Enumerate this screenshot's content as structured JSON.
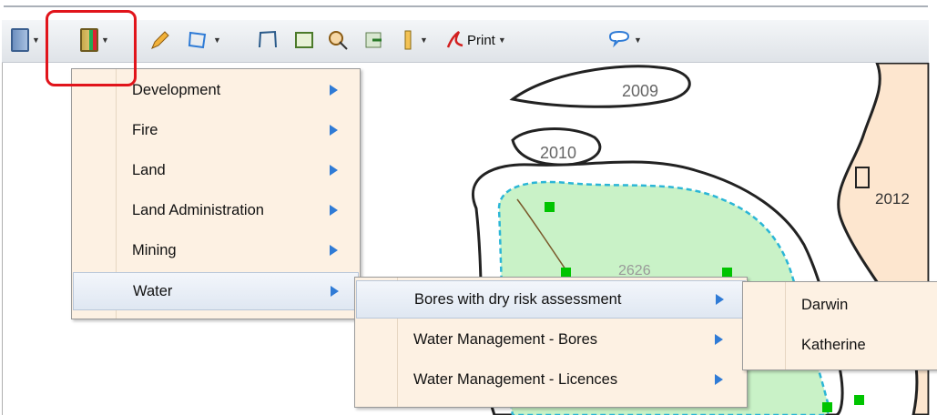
{
  "toolbar": {
    "print_label": "Print",
    "icons": [
      "layers-book-icon",
      "thematic-book-icon",
      "pencil-icon",
      "polygon-select-icon",
      "polyline-icon",
      "polygon-edit-icon",
      "identify-icon",
      "export-icon",
      "brightness-icon",
      "pdf-icon",
      "print-icon",
      "comment-icon"
    ]
  },
  "map": {
    "labels": [
      "2009",
      "2010",
      "2012",
      "2626"
    ]
  },
  "menu1": {
    "items": [
      {
        "label": "Development"
      },
      {
        "label": "Fire"
      },
      {
        "label": "Land"
      },
      {
        "label": "Land Administration"
      },
      {
        "label": "Mining"
      },
      {
        "label": "Water"
      }
    ]
  },
  "menu2": {
    "items": [
      {
        "label": "Bores with dry risk assessment"
      },
      {
        "label": "Water Management - Bores"
      },
      {
        "label": "Water Management - Licences"
      }
    ]
  },
  "menu3": {
    "items": [
      {
        "label": "Darwin"
      },
      {
        "label": "Katherine"
      }
    ]
  },
  "colors": {
    "menu_bg": "#fdf1e3",
    "submenu_arrow": "#2f7bd6",
    "highlight_box": "#e1141b",
    "water_fill": "#c9f2c7",
    "bore_marker": "#00c400"
  }
}
